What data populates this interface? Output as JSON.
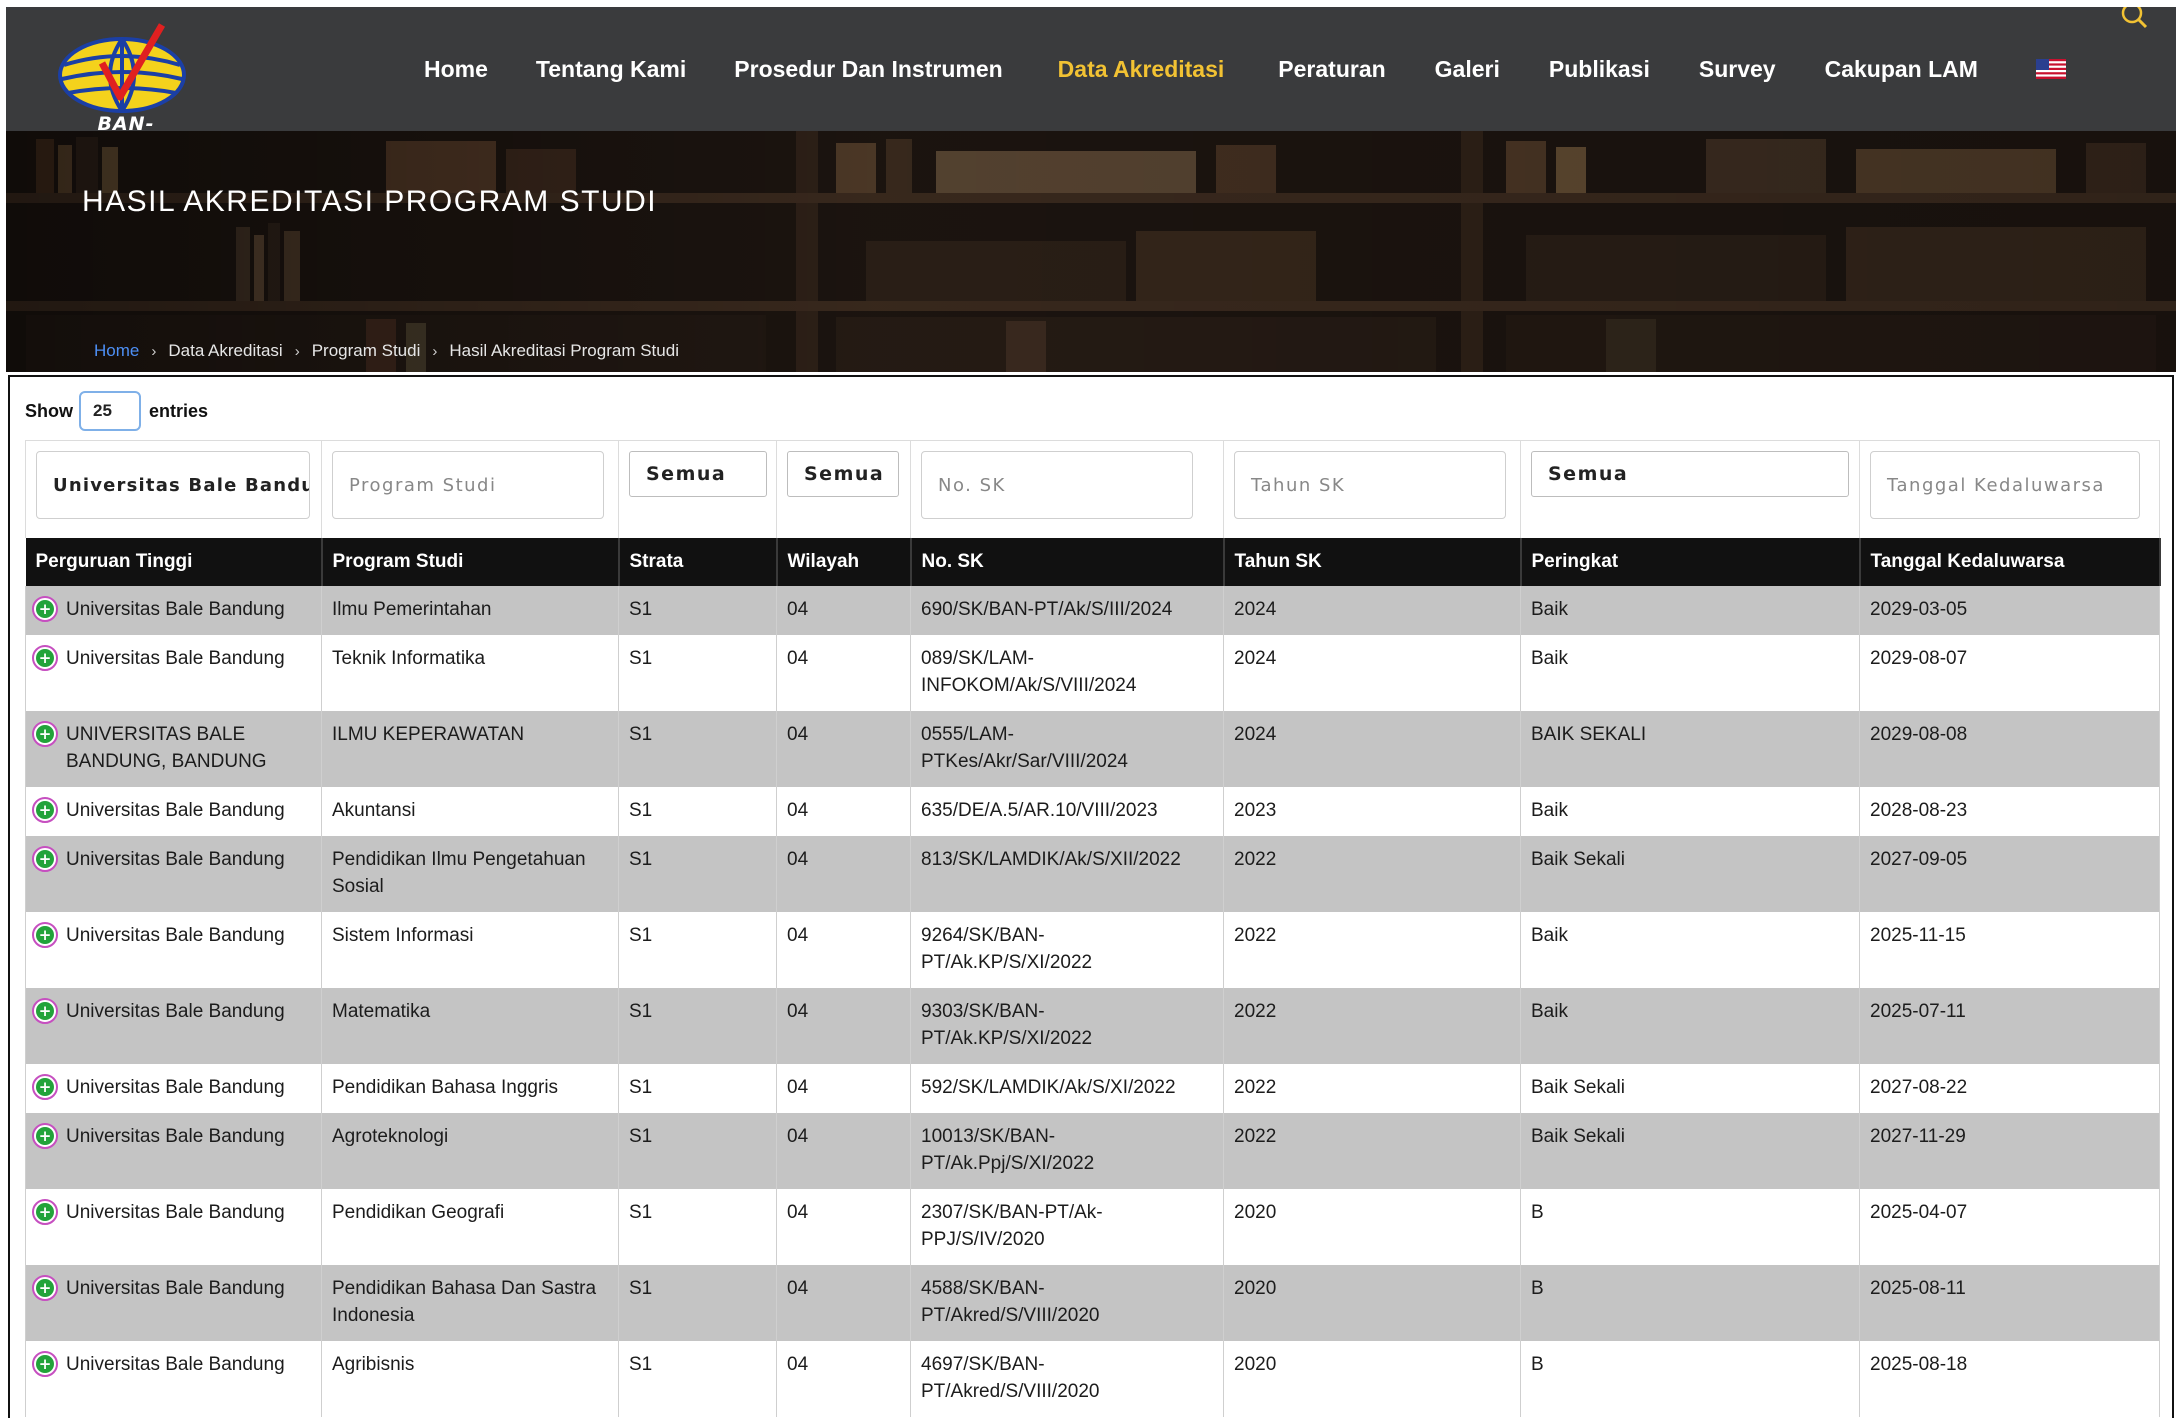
{
  "nav": {
    "logo_text": "BAN-PT",
    "items": [
      "Home",
      "Tentang Kami",
      "Prosedur Dan Instrumen",
      "Data Akreditasi",
      "Peraturan",
      "Galeri",
      "Publikasi",
      "Survey",
      "Cakupan LAM"
    ],
    "active_item": "Data Akreditasi",
    "active_color": "#f2c233",
    "language_icon": "us-flag-icon"
  },
  "hero": {
    "title": "HASIL AKREDITASI PROGRAM STUDI",
    "breadcrumb": [
      "Home",
      "Data Akreditasi",
      "Program Studi",
      "Hasil Akreditasi Program Studi"
    ]
  },
  "controls": {
    "show_label": "Show",
    "entries_value": "25",
    "entries_label": "entries"
  },
  "filters": {
    "perguruan_tinggi": "Universitas Bale Bandung",
    "program_studi_placeholder": "Program Studi",
    "strata": "Semua",
    "wilayah": "Semua",
    "no_sk_placeholder": "No. SK",
    "tahun_sk_placeholder": "Tahun SK",
    "peringkat": "Semua",
    "tanggal_placeholder": "Tanggal Kedaluwarsa"
  },
  "columns": [
    "Perguruan Tinggi",
    "Program Studi",
    "Strata",
    "Wilayah",
    "No. SK",
    "Tahun SK",
    "Peringkat",
    "Tanggal Kedaluwarsa"
  ],
  "rows": [
    {
      "pt": "Universitas Bale Bandung",
      "prodi": "Ilmu Pemerintahan",
      "strata": "S1",
      "wilayah": "04",
      "sk": "690/SK/BAN-PT/Ak/S/III/2024",
      "tahun": "2024",
      "peringkat": "Baik",
      "tanggal": "2029-03-05"
    },
    {
      "pt": "Universitas Bale Bandung",
      "prodi": "Teknik Informatika",
      "strata": "S1",
      "wilayah": "04",
      "sk": "089/SK/LAM-INFOKOM/Ak/S/VIII/2024",
      "tahun": "2024",
      "peringkat": "Baik",
      "tanggal": "2029-08-07"
    },
    {
      "pt": "UNIVERSITAS BALE BANDUNG, BANDUNG",
      "prodi": "ILMU KEPERAWATAN",
      "strata": "S1",
      "wilayah": "04",
      "sk": "0555/LAM-PTKes/Akr/Sar/VIII/2024",
      "tahun": "2024",
      "peringkat": "BAIK SEKALI",
      "tanggal": "2029-08-08"
    },
    {
      "pt": "Universitas Bale Bandung",
      "prodi": "Akuntansi",
      "strata": "S1",
      "wilayah": "04",
      "sk": "635/DE/A.5/AR.10/VIII/2023",
      "tahun": "2023",
      "peringkat": "Baik",
      "tanggal": "2028-08-23"
    },
    {
      "pt": "Universitas Bale Bandung",
      "prodi": "Pendidikan Ilmu Pengetahuan Sosial",
      "strata": "S1",
      "wilayah": "04",
      "sk": "813/SK/LAMDIK/Ak/S/XII/2022",
      "tahun": "2022",
      "peringkat": "Baik Sekali",
      "tanggal": "2027-09-05"
    },
    {
      "pt": "Universitas Bale Bandung",
      "prodi": "Sistem Informasi",
      "strata": "S1",
      "wilayah": "04",
      "sk": "9264/SK/BAN-PT/Ak.KP/S/XI/2022",
      "tahun": "2022",
      "peringkat": "Baik",
      "tanggal": "2025-11-15"
    },
    {
      "pt": "Universitas Bale Bandung",
      "prodi": "Matematika",
      "strata": "S1",
      "wilayah": "04",
      "sk": "9303/SK/BAN-PT/Ak.KP/S/XI/2022",
      "tahun": "2022",
      "peringkat": "Baik",
      "tanggal": "2025-07-11"
    },
    {
      "pt": "Universitas Bale Bandung",
      "prodi": "Pendidikan Bahasa Inggris",
      "strata": "S1",
      "wilayah": "04",
      "sk": "592/SK/LAMDIK/Ak/S/XI/2022",
      "tahun": "2022",
      "peringkat": "Baik Sekali",
      "tanggal": "2027-08-22"
    },
    {
      "pt": "Universitas Bale Bandung",
      "prodi": "Agroteknologi",
      "strata": "S1",
      "wilayah": "04",
      "sk": "10013/SK/BAN-PT/Ak.Ppj/S/XI/2022",
      "tahun": "2022",
      "peringkat": "Baik Sekali",
      "tanggal": "2027-11-29"
    },
    {
      "pt": "Universitas Bale Bandung",
      "prodi": "Pendidikan Geografi",
      "strata": "S1",
      "wilayah": "04",
      "sk": "2307/SK/BAN-PT/Ak-PPJ/S/IV/2020",
      "tahun": "2020",
      "peringkat": "B",
      "tanggal": "2025-04-07"
    },
    {
      "pt": "Universitas Bale Bandung",
      "prodi": "Pendidikan Bahasa Dan Sastra Indonesia",
      "strata": "S1",
      "wilayah": "04",
      "sk": "4588/SK/BAN-PT/Akred/S/VIII/2020",
      "tahun": "2020",
      "peringkat": "B",
      "tanggal": "2025-08-11"
    },
    {
      "pt": "Universitas Bale Bandung",
      "prodi": "Agribisnis",
      "strata": "S1",
      "wilayah": "04",
      "sk": "4697/SK/BAN-PT/Akred/S/VIII/2020",
      "tahun": "2020",
      "peringkat": "B",
      "tanggal": "2025-08-18"
    }
  ]
}
